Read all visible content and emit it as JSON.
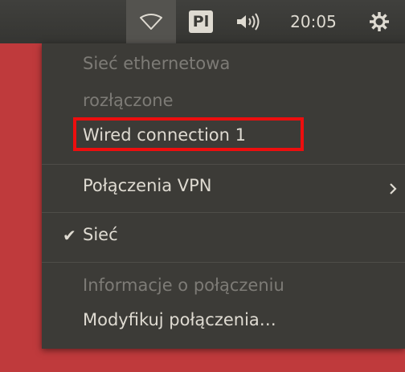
{
  "panel": {
    "network_icon": "wifi-icon",
    "keyboard_layout": "Pl",
    "sound_icon": "volume-icon",
    "clock": "20:05",
    "power_icon": "gear-icon"
  },
  "menu": {
    "ethernet_header": "Sieć ethernetowa",
    "ethernet_status": "rozłączone",
    "wired_connection": "Wired connection 1",
    "vpn": "Połączenia VPN",
    "network_toggle": "Sieć",
    "connection_info": "Informacje o połączeniu",
    "edit_connections": "Modyfikuj połączenia…"
  },
  "colors": {
    "panel": "#3c3b37",
    "menu_bg": "#3c3b37",
    "highlight": "#ed0e0e",
    "desktop": "#bf3a3c"
  }
}
